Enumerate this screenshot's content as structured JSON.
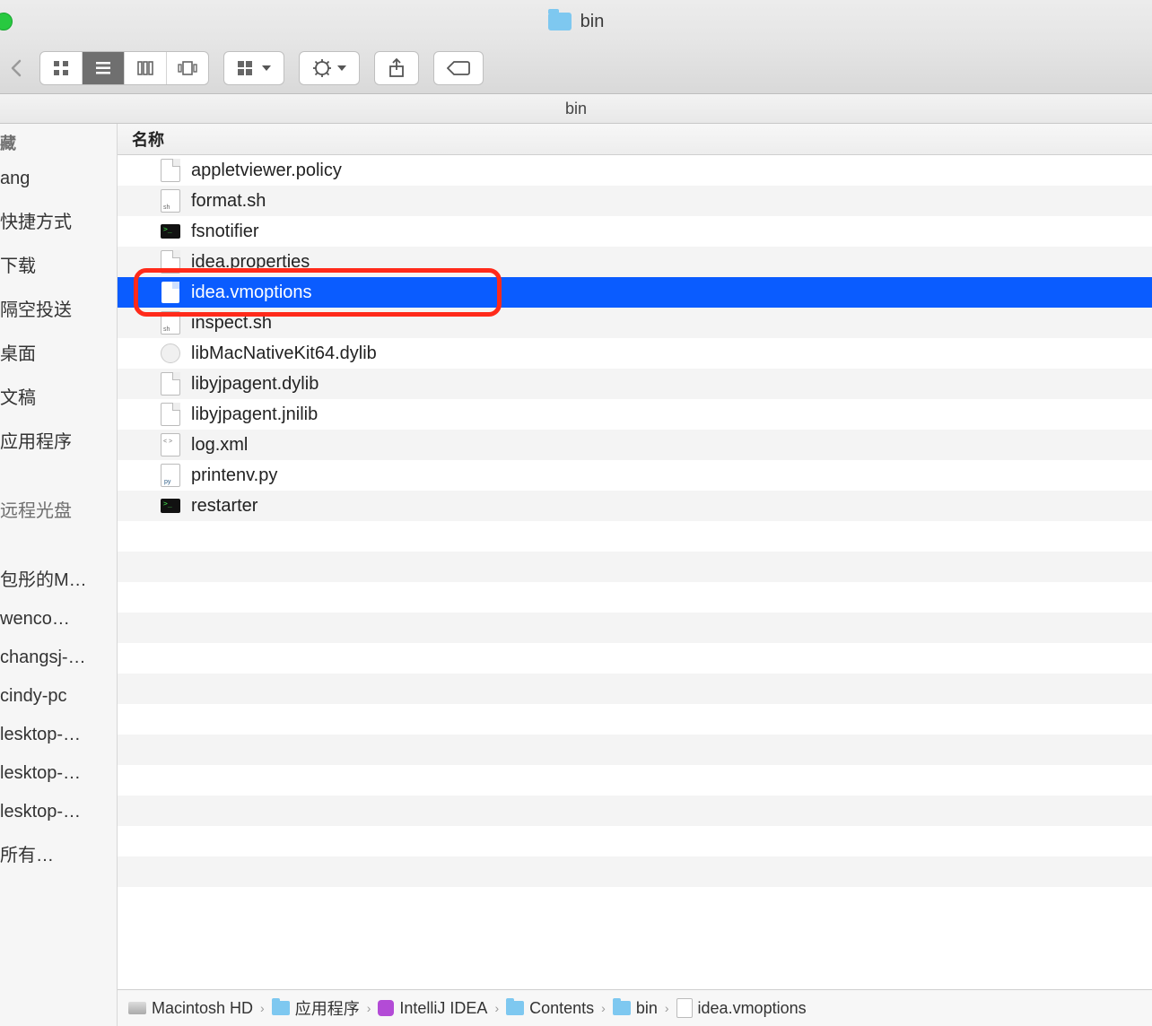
{
  "title": {
    "folder_name": "bin"
  },
  "subheader": {
    "label": "bin"
  },
  "sidebar": {
    "section1_label": "藏",
    "items1": [
      "ang",
      "快捷方式",
      "下载",
      "隔空投送",
      "桌面",
      "文稿",
      "应用程序"
    ],
    "section2_label": "远程光盘",
    "items2": [
      "包彤的M…",
      "wenco…",
      "changsj-…",
      "cindy-pc",
      "lesktop-…",
      "lesktop-…",
      "lesktop-…",
      "所有…"
    ]
  },
  "columns": {
    "name_header": "名称"
  },
  "files": [
    {
      "name": "appletviewer.policy",
      "icon": "doc",
      "selected": false
    },
    {
      "name": "format.sh",
      "icon": "shell",
      "selected": false
    },
    {
      "name": "fsnotifier",
      "icon": "exec",
      "selected": false
    },
    {
      "name": "idea.properties",
      "icon": "doc",
      "selected": false
    },
    {
      "name": "idea.vmoptions",
      "icon": "doc-sel",
      "selected": true,
      "highlight": true
    },
    {
      "name": "inspect.sh",
      "icon": "shell",
      "selected": false
    },
    {
      "name": "libMacNativeKit64.dylib",
      "icon": "plugin",
      "selected": false
    },
    {
      "name": "libyjpagent.dylib",
      "icon": "doc",
      "selected": false
    },
    {
      "name": "libyjpagent.jnilib",
      "icon": "doc",
      "selected": false
    },
    {
      "name": "log.xml",
      "icon": "xml",
      "selected": false
    },
    {
      "name": "printenv.py",
      "icon": "py",
      "selected": false
    },
    {
      "name": "restarter",
      "icon": "exec",
      "selected": false
    }
  ],
  "pathbar": [
    {
      "label": "Macintosh HD",
      "icon": "disk"
    },
    {
      "label": "应用程序",
      "icon": "folder"
    },
    {
      "label": "IntelliJ IDEA",
      "icon": "app"
    },
    {
      "label": "Contents",
      "icon": "folder"
    },
    {
      "label": "bin",
      "icon": "folder"
    },
    {
      "label": "idea.vmoptions",
      "icon": "doc"
    }
  ]
}
